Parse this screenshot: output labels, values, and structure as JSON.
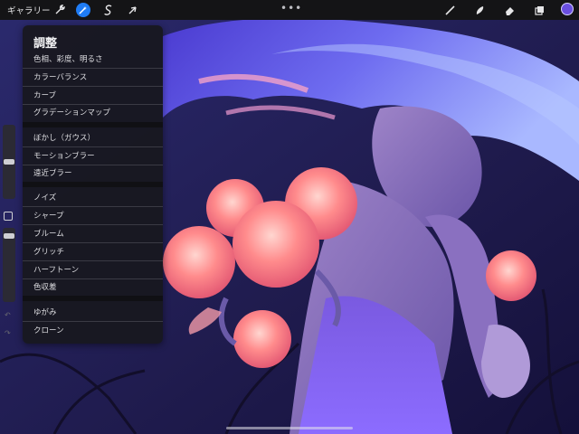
{
  "topbar": {
    "gallery_label": "ギャラリー",
    "more_label": "•••"
  },
  "adjust_menu": {
    "title": "調整",
    "groups": [
      [
        "色相、彩度、明るさ",
        "カラーバランス",
        "カーブ",
        "グラデーションマップ"
      ],
      [
        "ぼかし（ガウス）",
        "モーションブラー",
        "遠近ブラー"
      ],
      [
        "ノイズ",
        "シャープ",
        "ブルーム",
        "グリッチ",
        "ハーフトーン",
        "色収差"
      ],
      [
        "ゆがみ",
        "クローン"
      ]
    ]
  },
  "colors": {
    "accent": "#1f7cf5",
    "current_color": "#6a4fe0"
  },
  "icons": {
    "actions": "wrench-icon",
    "adjustments": "magic-wand-icon",
    "selection": "selection-s-icon",
    "transform": "arrow-cursor-icon",
    "brush": "brush-icon",
    "smudge": "smudge-icon",
    "eraser": "eraser-icon",
    "layers": "layers-icon",
    "modify": "square-modify-icon",
    "undo": "undo-icon",
    "redo": "redo-icon"
  }
}
